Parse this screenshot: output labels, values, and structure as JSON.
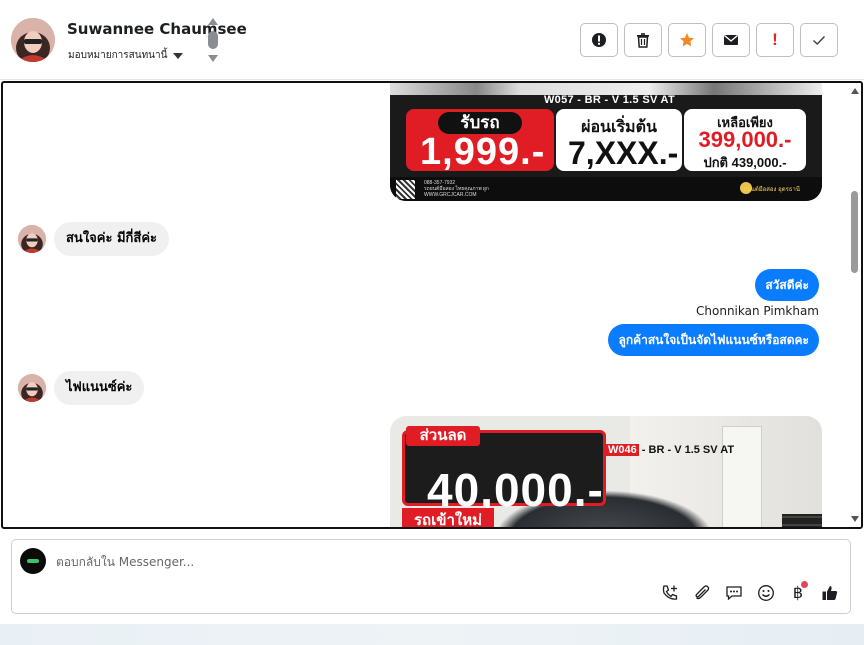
{
  "header": {
    "contact_name": "Suwannee Chaumsee",
    "assign_label": "มอบหมายการสนทนานี้",
    "toolbar": {
      "items": [
        {
          "name": "spam-icon",
          "color": "#1c1e21"
        },
        {
          "name": "trash-icon",
          "color": "#1c1e21"
        },
        {
          "name": "star-icon",
          "color": "#f08a24"
        },
        {
          "name": "mail-icon",
          "color": "#1c1e21"
        },
        {
          "name": "important-icon",
          "color": "#e0242c"
        },
        {
          "name": "check-icon",
          "color": "#1c1e21"
        }
      ],
      "important_glyph": "!"
    }
  },
  "conversation": {
    "card1": {
      "model": "W057 - BR - V 1.5 SV AT",
      "pickup_label": "รับรถ",
      "pickup_price": "1,999.-",
      "installment_label": "ผ่อนเริ่มต้น",
      "installment_price": "7,XXX.-",
      "only_label": "เหลือเพียง",
      "sale_price": "399,000.-",
      "normal_price": "ปกติ 439,000.-",
      "contact_lines": [
        "088-357-7932",
        "รถยนต์มือสอง ไทยคุณภาพ ผูก",
        "WWW.GRCJCAR.COM"
      ],
      "brand": "รถยนต์มือสอง อุดรธานี"
    },
    "msg_interested": "สนใจค่ะ  มีกี่สีค่ะ",
    "msg_hello": "สวัสดีค่ะ",
    "agent_name": "Chonnikan Pimkham",
    "msg_question": "ลูกค้าสนใจเป็นจัดไฟแนนซ์หรือสดคะ",
    "msg_finance": "ไฟแนนซ์ค่ะ",
    "card2": {
      "discount_label": "ส่วนลด",
      "discount_value": "40,000.-",
      "model_code": "W046",
      "model": " - BR - V 1.5 SV AT",
      "new_car": "รถเข้าใหม่"
    }
  },
  "composer": {
    "placeholder": "ตอบกลับใน Messenger...",
    "icons": [
      "phone-add-icon",
      "attach-icon",
      "saved-replies-icon",
      "emoji-icon",
      "payment-icon",
      "like-icon"
    ],
    "payment_glyph": "฿"
  },
  "colors": {
    "accent": "#0a7cff",
    "bubble_in": "#f0f0f0",
    "sale_red": "#e01d24"
  }
}
